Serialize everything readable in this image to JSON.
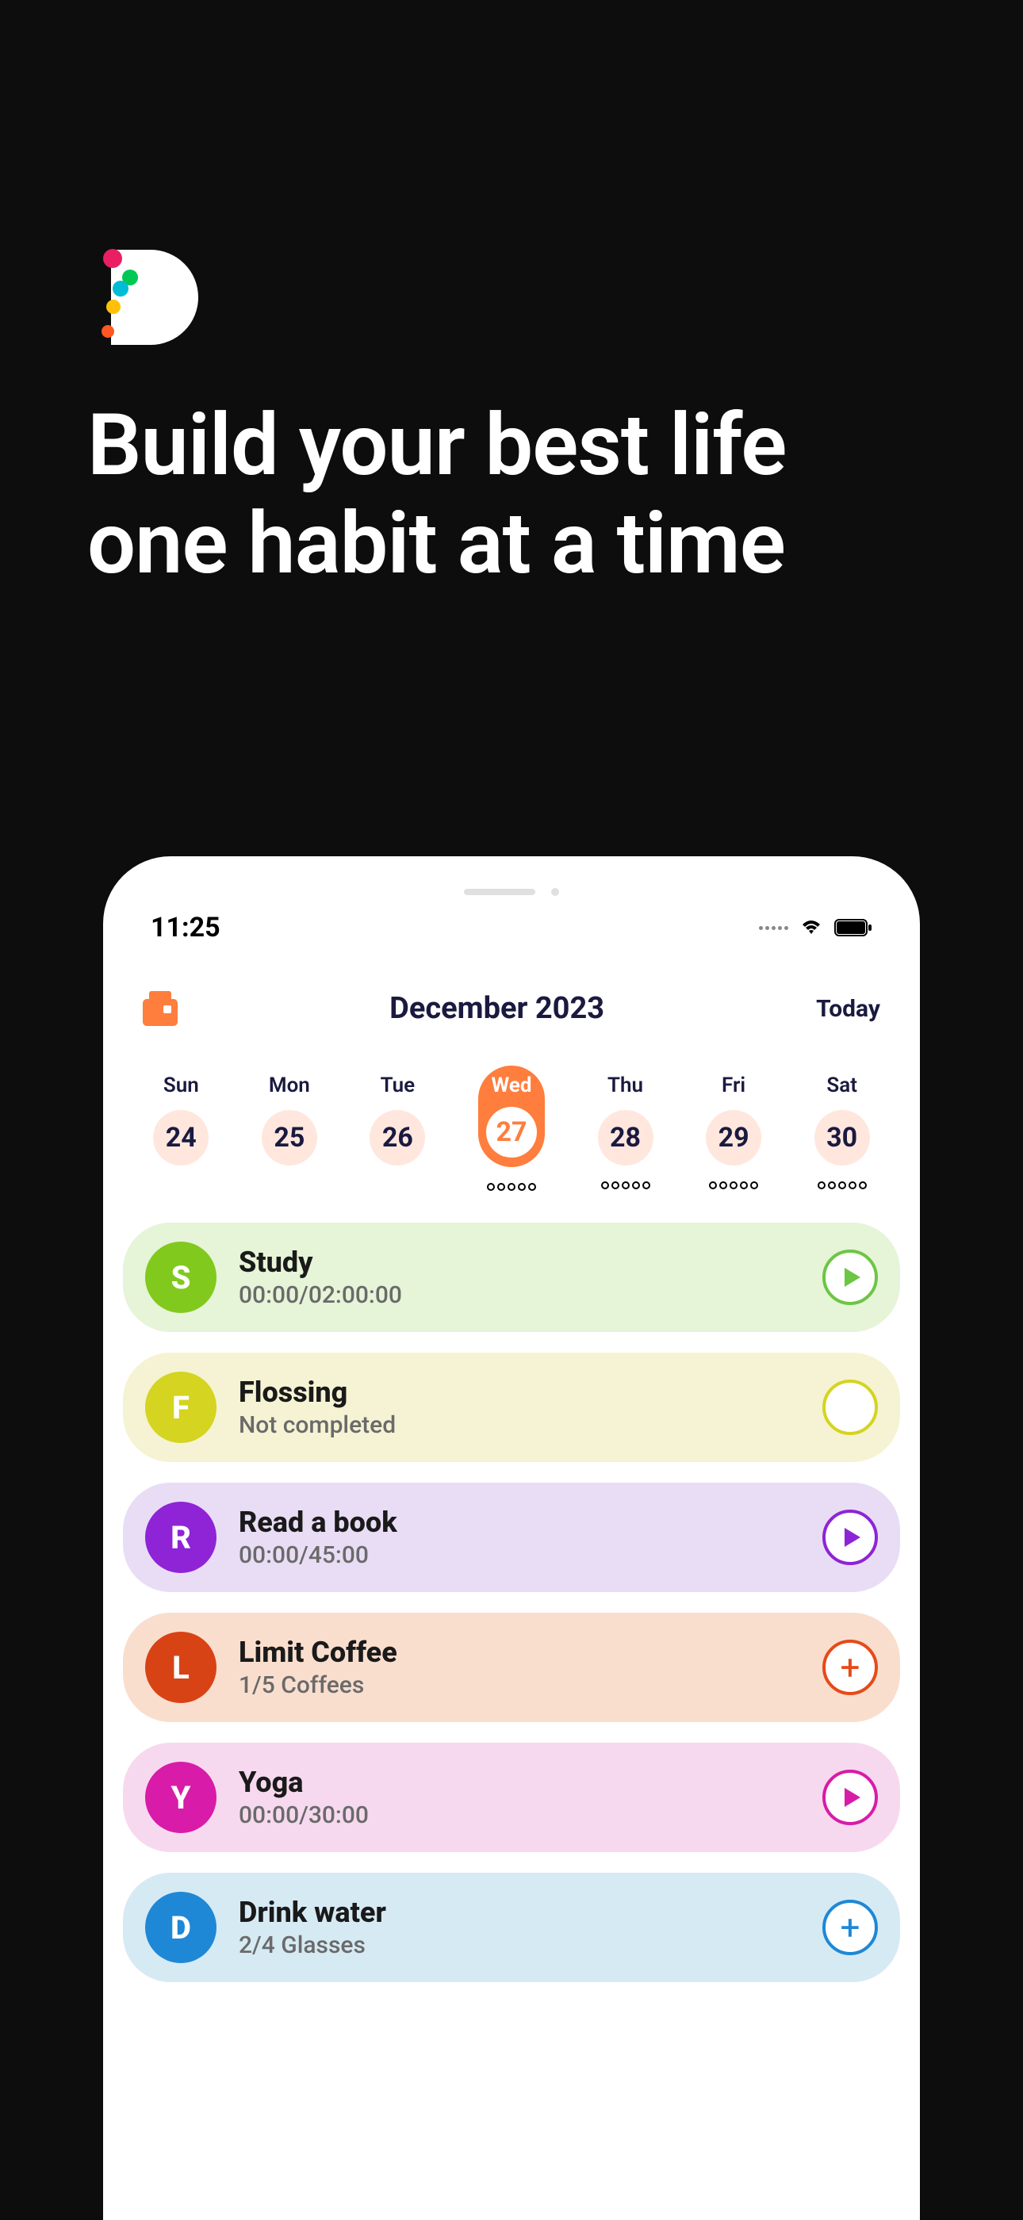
{
  "hero": {
    "title_line1": "Build your best life",
    "title_line2": "one habit at a time"
  },
  "status": {
    "time": "11:25"
  },
  "header": {
    "month": "December 2023",
    "today_label": "Today"
  },
  "week": [
    {
      "name": "Sun",
      "num": "24",
      "selected": false,
      "dots": false
    },
    {
      "name": "Mon",
      "num": "25",
      "selected": false,
      "dots": false
    },
    {
      "name": "Tue",
      "num": "26",
      "selected": false,
      "dots": false
    },
    {
      "name": "Wed",
      "num": "27",
      "selected": true,
      "dots": true
    },
    {
      "name": "Thu",
      "num": "28",
      "selected": false,
      "dots": true
    },
    {
      "name": "Fri",
      "num": "29",
      "selected": false,
      "dots": true
    },
    {
      "name": "Sat",
      "num": "30",
      "selected": false,
      "dots": true
    }
  ],
  "habits": [
    {
      "letter": "S",
      "title": "Study",
      "sub": "00:00/02:00:00",
      "action": "play",
      "theme": "study"
    },
    {
      "letter": "F",
      "title": "Flossing",
      "sub": "Not completed",
      "action": "empty",
      "theme": "floss"
    },
    {
      "letter": "R",
      "title": "Read a book",
      "sub": "00:00/45:00",
      "action": "play",
      "theme": "read"
    },
    {
      "letter": "L",
      "title": "Limit Coffee",
      "sub": "1/5 Coffees",
      "action": "plus",
      "theme": "coffee"
    },
    {
      "letter": "Y",
      "title": "Yoga",
      "sub": "00:00/30:00",
      "action": "play",
      "theme": "yoga"
    },
    {
      "letter": "D",
      "title": "Drink water",
      "sub": "2/4 Glasses",
      "action": "plus",
      "theme": "water"
    }
  ]
}
